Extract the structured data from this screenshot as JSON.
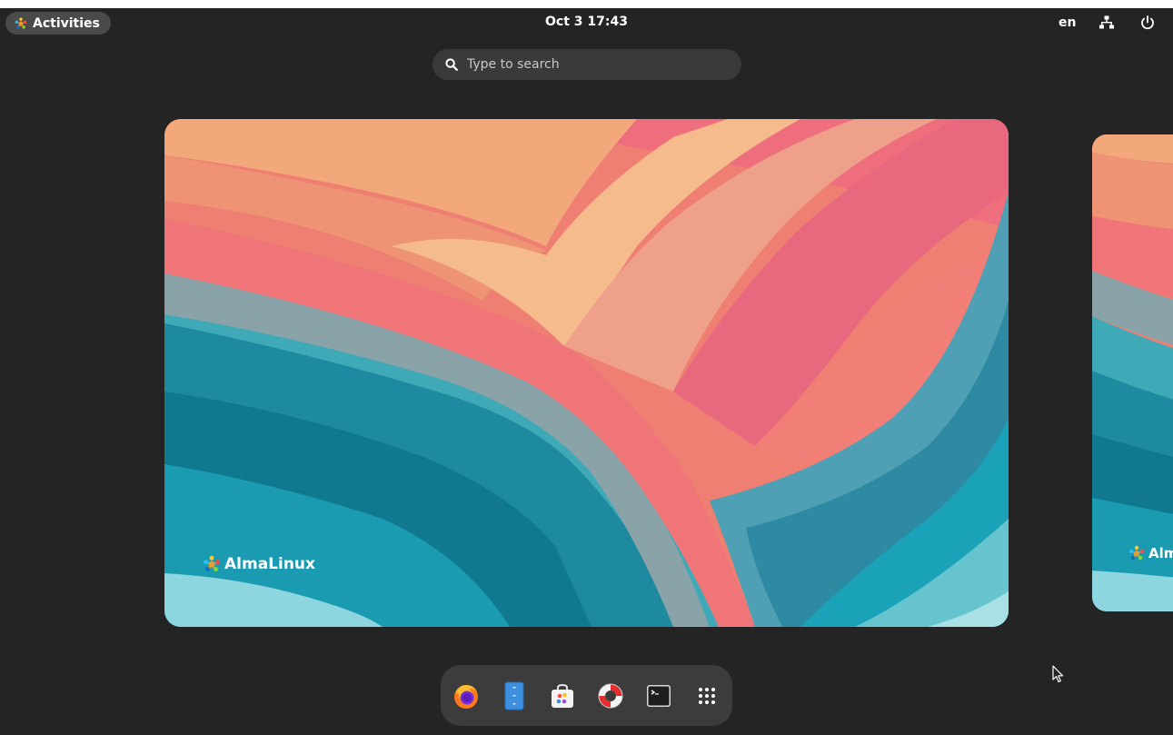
{
  "topbar": {
    "activities_label": "Activities",
    "clock": "Oct 3  17:43",
    "keyboard_layout": "en",
    "icons": [
      "almalinux-logo-icon",
      "network-wired-icon",
      "power-icon"
    ]
  },
  "search": {
    "placeholder": "Type to search",
    "icon": "search-icon"
  },
  "workspaces": [
    {
      "name": "current-workspace",
      "brand_text": "AlmaLinux"
    },
    {
      "name": "next-workspace",
      "brand_text": "AlmaLinux"
    }
  ],
  "dash": {
    "items": [
      {
        "name": "firefox",
        "icon": "firefox-icon"
      },
      {
        "name": "files",
        "icon": "files-icon"
      },
      {
        "name": "software",
        "icon": "software-bag-icon"
      },
      {
        "name": "help",
        "icon": "help-lifebuoy-icon"
      },
      {
        "name": "terminal",
        "icon": "terminal-icon"
      },
      {
        "name": "show-apps",
        "icon": "app-grid-icon"
      }
    ]
  },
  "colors": {
    "panel": "#242424",
    "search_bg": "#3a3a3a",
    "dash_bg": "#3c3c3c",
    "activities_bg": "#4a4a4a"
  }
}
